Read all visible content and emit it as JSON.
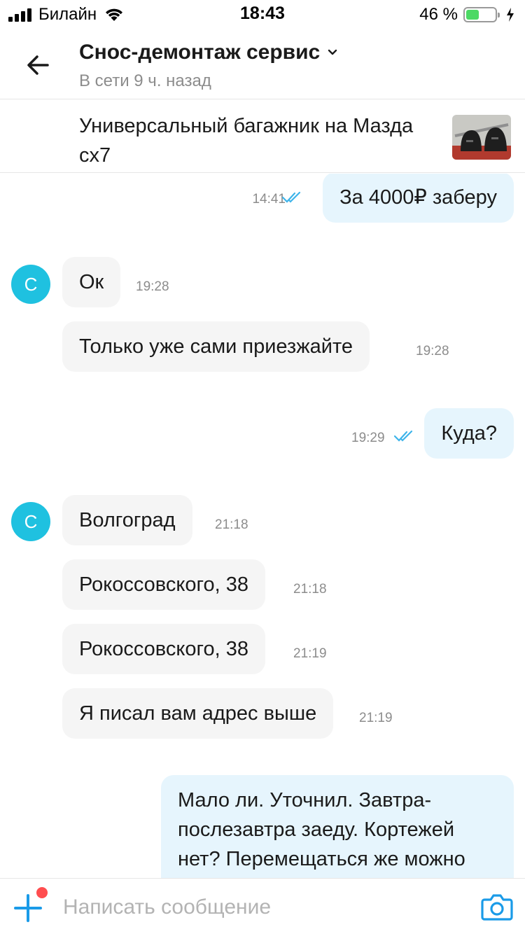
{
  "status_bar": {
    "carrier": "Билайн",
    "time": "18:43",
    "battery": "46 %",
    "battery_level": 0.46
  },
  "header": {
    "title": "Снос-демонтаж сервис",
    "subtitle": "В сети 9 ч. назад"
  },
  "listing": {
    "title": "Универсальный багажник на Мазда сх7"
  },
  "avatar_letter": "С",
  "messages": [
    {
      "side": "out",
      "text": "За 4000₽ заберу",
      "time": "14:41",
      "read": true
    },
    {
      "side": "in",
      "text": "Ок",
      "time": "19:28"
    },
    {
      "side": "in",
      "text": "Только уже  сами приезжайте",
      "time": "19:28"
    },
    {
      "side": "out",
      "text": "Куда?",
      "time": "19:29",
      "read": true
    },
    {
      "side": "in",
      "text": "Волгоград",
      "time": "21:18"
    },
    {
      "side": "in",
      "text": "Рокоссовского, 38",
      "time": "21:18"
    },
    {
      "side": "in",
      "text": "Рокоссовского, 38",
      "time": "21:19"
    },
    {
      "side": "in",
      "text": "Я писал вам адрес выше",
      "time": "21:19"
    },
    {
      "side": "out",
      "text": "Мало ли. Уточнил. Завтра-послезавтра заеду. Кортежей нет? Перемещаться же можно"
    }
  ],
  "composer": {
    "placeholder": "Написать сообщение"
  },
  "colors": {
    "accent": "#1a9be8",
    "avatar": "#1fc1e0",
    "out_bubble": "#e6f5fd",
    "in_bubble": "#f5f5f5",
    "notification_dot": "#ff4d4f"
  },
  "icons": [
    "back-arrow-icon",
    "chevron-down-icon",
    "double-check-icon",
    "plus-icon",
    "camera-icon",
    "wifi-icon",
    "signal-icon",
    "battery-icon",
    "charging-icon"
  ]
}
